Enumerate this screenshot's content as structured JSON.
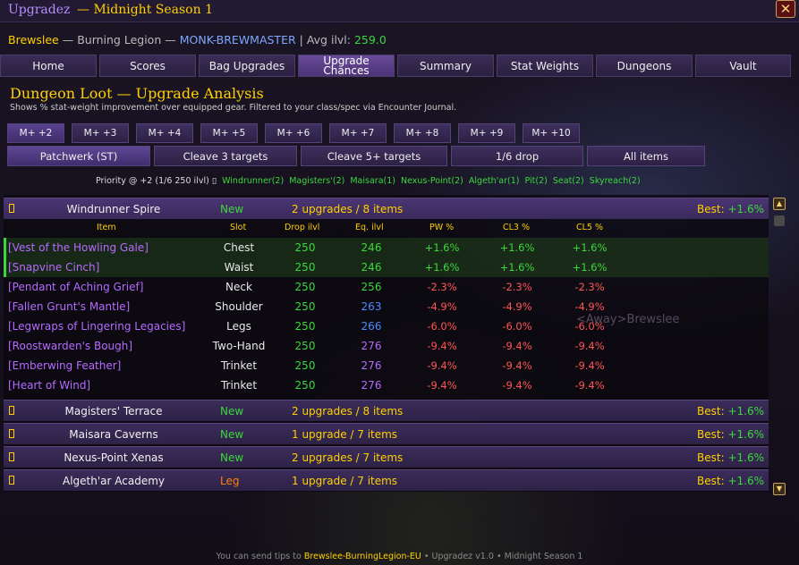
{
  "app": {
    "title": "Upgradez",
    "season": "— Midnight Season 1",
    "close_glyph": "✕"
  },
  "character": {
    "name": "Brewslee",
    "realm": "— Burning Legion —",
    "spec": "MONK-BREWMASTER",
    "separator": "|",
    "ilvl_label": "Avg ilvl:",
    "ilvl_value": "259.0"
  },
  "tabs": [
    {
      "label": "Home"
    },
    {
      "label": "Scores"
    },
    {
      "label": "Bag Upgrades"
    },
    {
      "label": "Upgrade Chances",
      "line1": "Upgrade",
      "line2": "Chances",
      "active": true
    },
    {
      "label": "Summary"
    },
    {
      "label": "Stat Weights"
    },
    {
      "label": "Dungeons"
    },
    {
      "label": "Vault"
    }
  ],
  "section": {
    "title": "Dungeon Loot — Upgrade Analysis",
    "subtitle": "Shows % stat-weight improvement over equipped gear. Filtered to your class/spec via Encounter Journal."
  },
  "keystone_buttons": [
    "M+ +2",
    "M+ +3",
    "M+ +4",
    "M+ +5",
    "M+ +6",
    "M+ +7",
    "M+ +8",
    "M+ +9",
    "M+ +10"
  ],
  "target_buttons": [
    "Patchwerk (ST)",
    "Cleave 3 targets",
    "Cleave 5+ targets",
    "1/6 drop",
    "All items"
  ],
  "priority": {
    "label": "Priority @ +2 (1/6 250 ilvl)",
    "box_glyph": "▯",
    "items": [
      "Windrunner(2)",
      "Magisters'(2)",
      "Maisara(1)",
      "Nexus-Point(2)",
      "Algeth'ar(1)",
      "Pit(2)",
      "Seat(2)",
      "Skyreach(2)"
    ]
  },
  "columns": [
    "Item",
    "Slot",
    "Drop ilvl",
    "Eq. ilvl",
    "PW %",
    "CL3 %",
    "CL5 %"
  ],
  "dungeons": [
    {
      "name": "Windrunner Spire",
      "status": "New",
      "summary": "2 upgrades / 8 items",
      "best_label": "Best:",
      "best_value": "+1.6%"
    },
    {
      "name": "Magisters' Terrace",
      "status": "New",
      "summary": "2 upgrades / 8 items",
      "best_label": "Best:",
      "best_value": "+1.6%"
    },
    {
      "name": "Maisara Caverns",
      "status": "New",
      "summary": "1 upgrade / 7 items",
      "best_label": "Best:",
      "best_value": "+1.6%"
    },
    {
      "name": "Nexus-Point Xenas",
      "status": "New",
      "summary": "2 upgrades / 7 items",
      "best_label": "Best:",
      "best_value": "+1.6%"
    },
    {
      "name": "Algeth'ar Academy",
      "status": "Leg",
      "summary": "1 upgrade / 7 items",
      "best_label": "Best:",
      "best_value": "+1.6%"
    }
  ],
  "items": [
    {
      "name": "[Vest of the Howling Gale]",
      "slot": "Chest",
      "drop": "250",
      "eq": "246",
      "pw": "+1.6%",
      "cl3": "+1.6%",
      "cl5": "+1.6%"
    },
    {
      "name": "[Snapvine Cinch]",
      "slot": "Waist",
      "drop": "250",
      "eq": "246",
      "pw": "+1.6%",
      "cl3": "+1.6%",
      "cl5": "+1.6%"
    },
    {
      "name": "[Pendant of Aching Grief]",
      "slot": "Neck",
      "drop": "250",
      "eq": "256",
      "pw": "-2.3%",
      "cl3": "-2.3%",
      "cl5": "-2.3%"
    },
    {
      "name": "[Fallen Grunt's Mantle]",
      "slot": "Shoulder",
      "drop": "250",
      "eq": "263",
      "pw": "-4.9%",
      "cl3": "-4.9%",
      "cl5": "-4.9%"
    },
    {
      "name": "[Legwraps of Lingering Legacies]",
      "slot": "Legs",
      "drop": "250",
      "eq": "266",
      "pw": "-6.0%",
      "cl3": "-6.0%",
      "cl5": "-6.0%"
    },
    {
      "name": "[Roostwarden's Bough]",
      "slot": "Two-Hand",
      "drop": "250",
      "eq": "276",
      "pw": "-9.4%",
      "cl3": "-9.4%",
      "cl5": "-9.4%"
    },
    {
      "name": "[Emberwing Feather]",
      "slot": "Trinket",
      "drop": "250",
      "eq": "276",
      "pw": "-9.4%",
      "cl3": "-9.4%",
      "cl5": "-9.4%"
    },
    {
      "name": "[Heart of Wind]",
      "slot": "Trinket",
      "drop": "250",
      "eq": "276",
      "pw": "-9.4%",
      "cl3": "-9.4%",
      "cl5": "-9.4%"
    }
  ],
  "chat_ghost": "<Away>Brewslee",
  "footer": {
    "prefix": "You can send tips to",
    "tip_name": "Brewslee-BurningLegion-EU",
    "sep1": "•",
    "version": "Upgradez v1.0",
    "sep2": "•",
    "season": "Midnight Season 1"
  },
  "colors": {
    "accent": "#ffd100",
    "upgrade": "#3bd83b",
    "downgrade": "#ff5555",
    "epic": "#b56bff",
    "rare": "#4a8cff"
  }
}
